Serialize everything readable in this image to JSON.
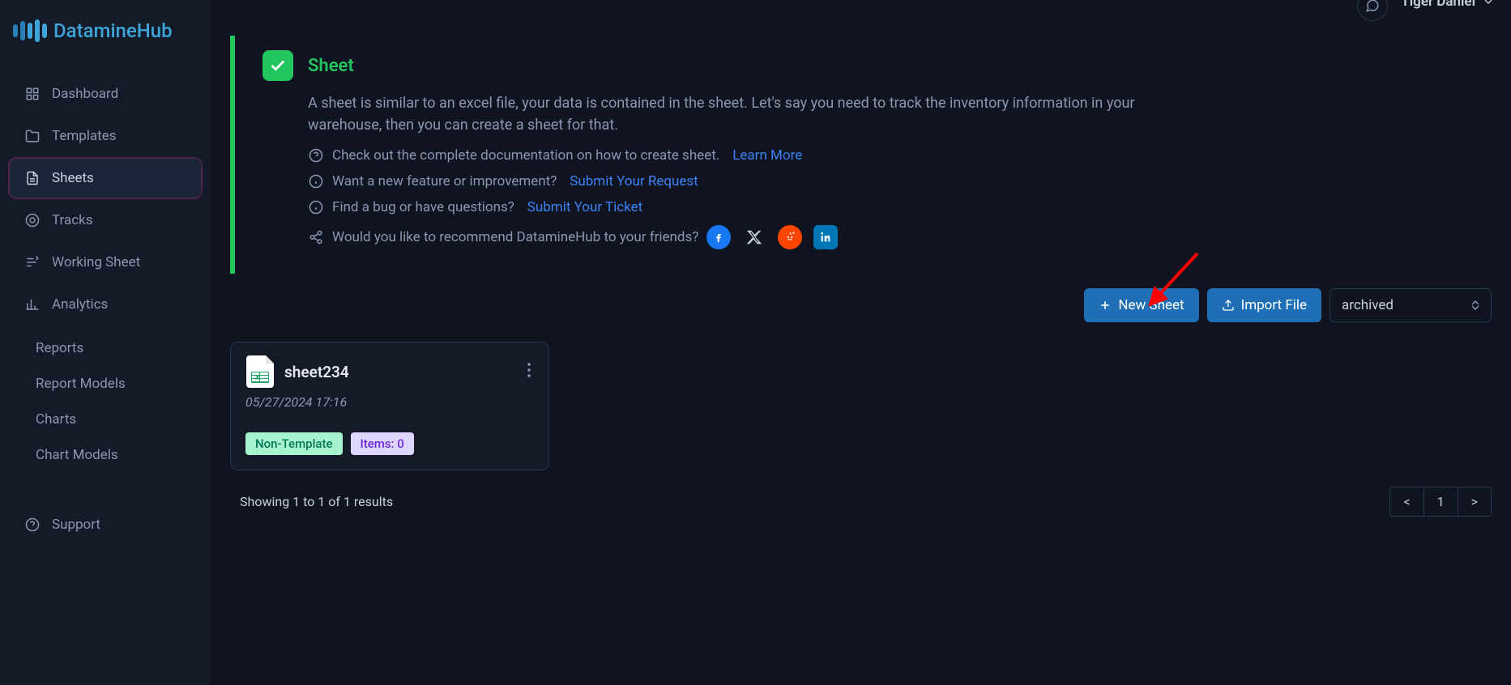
{
  "brand": "DatamineHub",
  "user": {
    "name": "Tiger Daniel"
  },
  "sidebar": {
    "items": [
      {
        "label": "Dashboard"
      },
      {
        "label": "Templates"
      },
      {
        "label": "Sheets"
      },
      {
        "label": "Tracks"
      },
      {
        "label": "Working Sheet"
      },
      {
        "label": "Analytics"
      }
    ],
    "sub_items": [
      {
        "label": "Reports"
      },
      {
        "label": "Report Models"
      },
      {
        "label": "Charts"
      },
      {
        "label": "Chart Models"
      }
    ],
    "support": {
      "label": "Support"
    }
  },
  "banner": {
    "title": "Sheet",
    "description": "A sheet is similar to an excel file, your data is contained in the sheet. Let's say you need to track the inventory information in your warehouse, then you can create a sheet for that.",
    "rows": [
      {
        "text": "Check out the complete documentation on how to create sheet.",
        "link": "Learn More"
      },
      {
        "text": "Want a new feature or improvement?",
        "link": "Submit Your Request"
      },
      {
        "text": "Find a bug or have questions?",
        "link": "Submit Your Ticket"
      }
    ],
    "share_text": "Would you like to recommend DatamineHub to your friends?"
  },
  "toolbar": {
    "new_sheet_label": "New Sheet",
    "import_file_label": "Import File",
    "filter_value": "archived"
  },
  "sheets": [
    {
      "name": "sheet234",
      "date": "05/27/2024 17:16",
      "tag_template": "Non-Template",
      "tag_items": "Items: 0"
    }
  ],
  "footer": {
    "results_text": "Showing 1 to 1 of 1 results",
    "prev": "<",
    "page": "1",
    "next": ">"
  }
}
